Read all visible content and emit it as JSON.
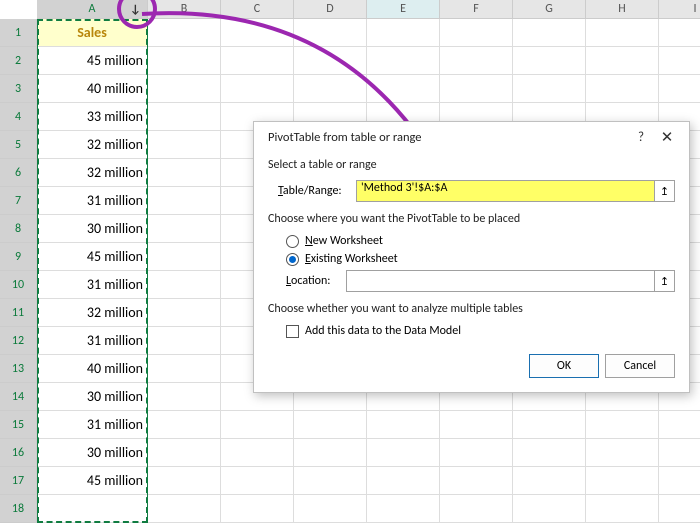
{
  "columns": [
    "A",
    "B",
    "C",
    "D",
    "E",
    "F",
    "G",
    "H",
    "I"
  ],
  "rows_visible": 18,
  "sales_header": "Sales",
  "sales": [
    "45 million",
    "40 million",
    "33 million",
    "32 million",
    "32 million",
    "31 million",
    "30 million",
    "45 million",
    "31 million",
    "32 million",
    "31 million",
    "40 million",
    "30 million",
    "31 million",
    "30 million",
    "45 million"
  ],
  "dialog": {
    "title": "PivotTable from table or range",
    "section1": "Select a table or range",
    "table_range_label_pre": "T",
    "table_range_label_rest": "able/Range:",
    "table_range_value": "'Method 3'!$A:$A",
    "section2": "Choose where you want the PivotTable to be placed",
    "opt_new_u": "N",
    "opt_new_rest": "ew Worksheet",
    "opt_existing_u": "E",
    "opt_existing_rest": "xisting Worksheet",
    "location_label_u": "L",
    "location_label_rest": "ocation:",
    "location_value": "",
    "section3": "Choose whether you want to analyze multiple tables",
    "chk_label": "Add this data to the Data Model",
    "ok": "OK",
    "cancel": "Cancel"
  }
}
